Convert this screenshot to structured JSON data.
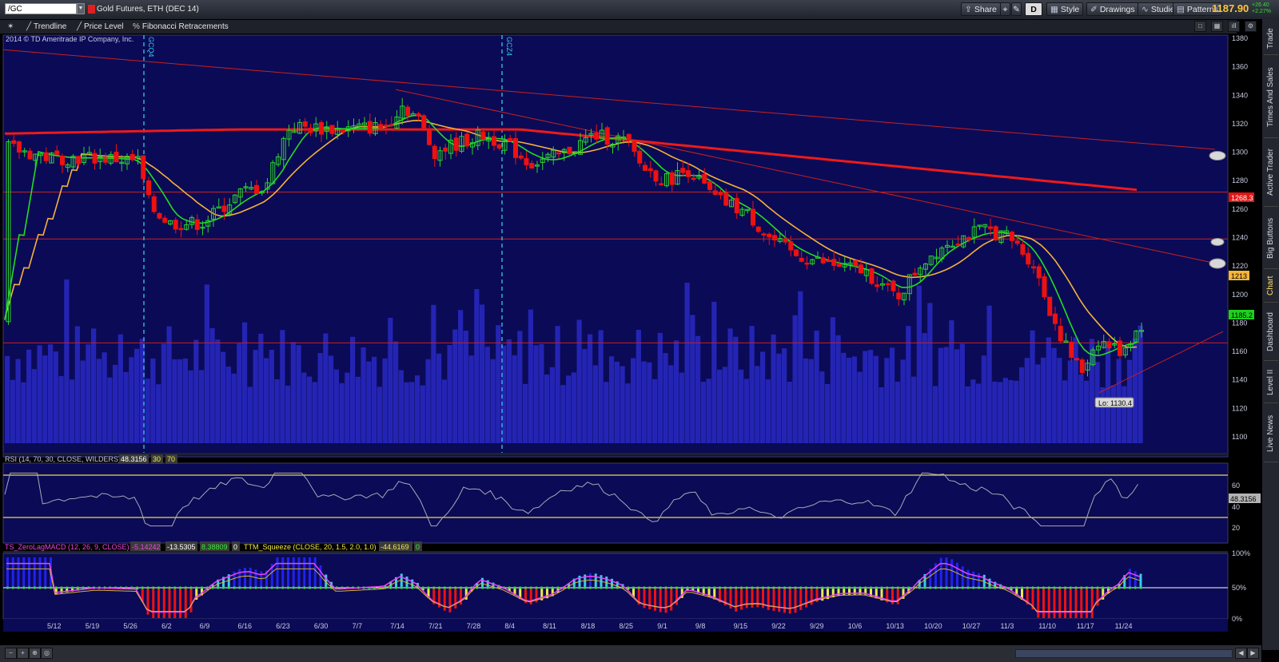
{
  "toolbar": {
    "symbol": "/GC",
    "instrument_title": "Gold Futures, ETH (DEC 14)",
    "share_label": "Share",
    "timeframe_label": "D",
    "style_label": "Style",
    "drawings_label": "Drawings",
    "studies_label": "Studies",
    "patterns_label": "Patterns",
    "last_price": "1187.90",
    "net_change": "+26.40",
    "pct_change": "+2.27%"
  },
  "drawbar": {
    "trendline_label": "Trendline",
    "price_level_label": "Price Level",
    "fibonacci_label": "Fibonacci Retracements"
  },
  "side_tabs": [
    "Trade",
    "Times And Sales",
    "Active Trader",
    "Big Buttons",
    "Chart",
    "Dashboard",
    "Level II",
    "Live News"
  ],
  "chart": {
    "copyright": "2014 © TD Ameritrade IP Company, Inc.",
    "expiry_markers": [
      "GCQ4",
      "GCZ4"
    ],
    "price_ticks": [
      "1380",
      "1360",
      "1340",
      "1320",
      "1300",
      "1280",
      "1260",
      "1240",
      "1220",
      "1200",
      "1180",
      "1160",
      "1140",
      "1120",
      "1100"
    ],
    "price_tags": {
      "ma200": "1268.3",
      "ma50": "1213",
      "last": "1185.2"
    },
    "low_label": "Lo: 1130.4"
  },
  "rsi_panel": {
    "study": "RSI (14, 70, 30, CLOSE, WILDERS)",
    "value": "48.3156",
    "oversold": "30",
    "overbought": "70",
    "ticks": [
      "60",
      "40",
      "20"
    ],
    "value_tag": "48.3156"
  },
  "macd_panel": {
    "study": "TS_ZeroLagMACD (12, 26, 9, CLOSE)",
    "v1": "-5.14242",
    "v2": "-13.5305",
    "v3": "8.38809",
    "v4": "0",
    "squeeze_study": "TTM_Squeeze (CLOSE, 20, 1.5, 2.0, 1.0)",
    "squeeze_value": "-44.6169",
    "squeeze_flag": "0",
    "ticks": [
      "100%",
      "50%",
      "0%"
    ]
  },
  "x_axis": [
    "5/12",
    "5/19",
    "5/26",
    "6/2",
    "6/9",
    "6/16",
    "6/23",
    "6/30",
    "7/7",
    "7/14",
    "7/21",
    "7/28",
    "8/4",
    "8/11",
    "8/18",
    "8/25",
    "9/1",
    "9/8",
    "9/15",
    "9/22",
    "9/29",
    "10/6",
    "10/13",
    "10/20",
    "10/27",
    "11/3",
    "11/10",
    "11/17",
    "11/24"
  ],
  "colors": {
    "panel_bg": "#0b0a56",
    "volume": "#2424b4",
    "up_candle": "#2bd12b",
    "down_candle": "#ee1111",
    "ma200": "#ee1a1a",
    "ma50": "#f4b23a",
    "ma20": "#22dd22",
    "level_line": "#c82020"
  }
}
